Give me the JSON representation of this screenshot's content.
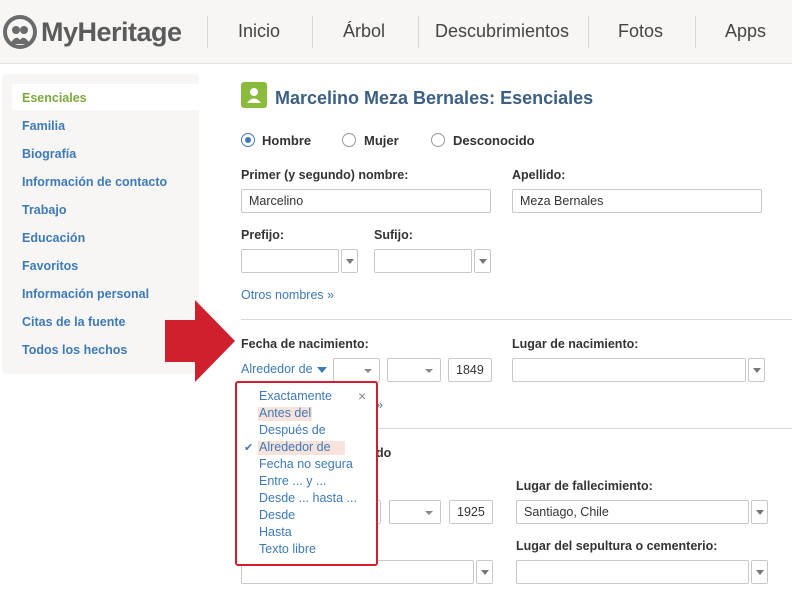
{
  "header": {
    "logo_text": "MyHeritage",
    "nav": [
      "Inicio",
      "Árbol",
      "Descubrimientos",
      "Fotos",
      "Apps"
    ]
  },
  "sidebar": {
    "items": [
      "Esenciales",
      "Familia",
      "Biografía",
      "Información de contacto",
      "Trabajo",
      "Educación",
      "Favoritos",
      "Información personal",
      "Citas de la fuente",
      "Todos los hechos"
    ],
    "active": "Esenciales"
  },
  "main": {
    "title": "Marcelino Meza Bernales: Esenciales",
    "gender": {
      "options": [
        "Hombre",
        "Mujer",
        "Desconocido"
      ],
      "selected": "Hombre"
    },
    "first_name_label": "Primer (y segundo) nombre:",
    "first_name_value": "Marcelino",
    "last_name_label": "Apellido:",
    "last_name_value": "Meza Bernales",
    "prefix_label": "Prefijo:",
    "suffix_label": "Sufijo:",
    "other_names_link": "Otros nombres »",
    "birth_date_label": "Fecha de nacimiento:",
    "birth_qualifier": "Alrededor de",
    "birth_year": "1849",
    "birth_place_label": "Lugar de nacimiento:",
    "birth_more_link_fragment": "»",
    "death_section_fragment": "do",
    "death_year": "1925",
    "death_place_label": "Lugar de fallecimiento:",
    "death_place_value": "Santiago, Chile",
    "burial_place_label": "Lugar del sepultura o cementerio:"
  },
  "dropdown": {
    "items": [
      "Exactamente",
      "Antes del",
      "Después de",
      "Alrededor de",
      "Fecha no segura",
      "Entre ... y ...",
      "Desde ... hasta ...",
      "Desde",
      "Hasta",
      "Texto libre"
    ],
    "selected": "Alrededor de",
    "hovered": "Antes del",
    "close_glyph": "×",
    "check_glyph": "✔"
  },
  "colors": {
    "accent_blue": "#3d7ab8",
    "active_green": "#7ba93b",
    "highlight_red": "#d0202e"
  }
}
